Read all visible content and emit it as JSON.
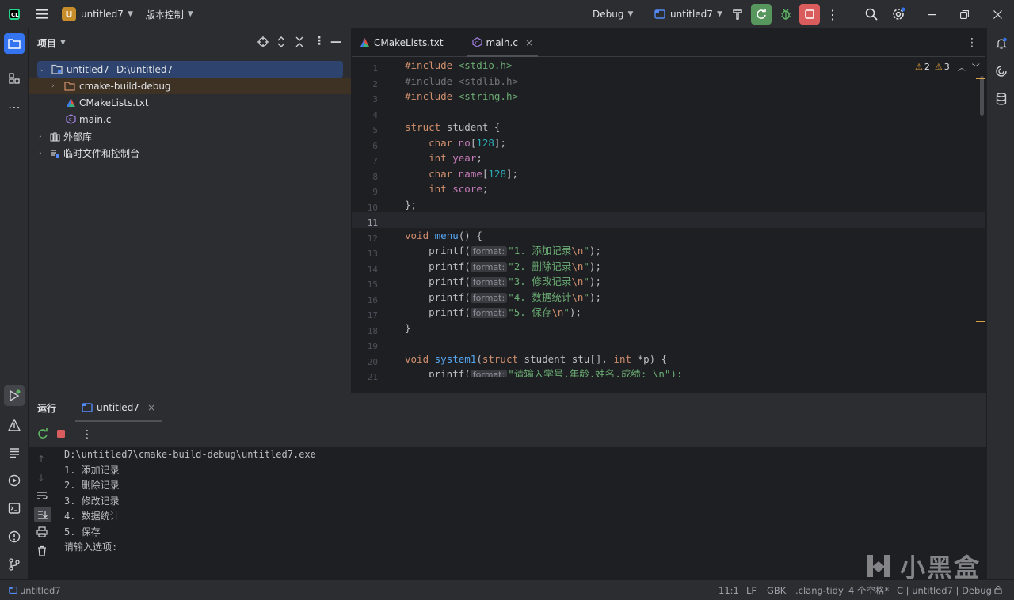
{
  "titlebar": {
    "project_initial": "U",
    "project_name": "untitled7",
    "vcs_label": "版本控制",
    "config_label": "Debug",
    "run_target": "untitled7"
  },
  "project_panel": {
    "title": "项目",
    "tree": [
      {
        "label": "untitled7",
        "path": "D:\\untitled7"
      },
      {
        "label": "cmake-build-debug"
      },
      {
        "label": "CMakeLists.txt"
      },
      {
        "label": "main.c"
      },
      {
        "label": "外部库"
      },
      {
        "label": "临时文件和控制台"
      }
    ]
  },
  "editor": {
    "tabs": [
      {
        "label": "CMakeLists.txt"
      },
      {
        "label": "main.c"
      }
    ],
    "warnings": {
      "weak": "2",
      "warn": "3"
    },
    "line_numbers": [
      "1",
      "2",
      "3",
      "4",
      "5",
      "6",
      "7",
      "8",
      "9",
      "10",
      "11",
      "12",
      "13",
      "14",
      "15",
      "16",
      "17",
      "18",
      "19",
      "20",
      "21"
    ],
    "hint_label": "format:",
    "lines": {
      "l1": "<stdio.h>",
      "l2": "<stdlib.h>",
      "l3": "<string.h>",
      "inc": "#include ",
      "struct_name": "student",
      "menu_items": [
        "\"1. 添加记录",
        "\"2. 删除记录",
        "\"3. 修改记录",
        "\"4. 数据统计",
        "\"5. 保存"
      ],
      "line21_str": "\"请输入学号,年龄,姓名,成绩: \\n\");"
    }
  },
  "run_panel": {
    "title": "运行",
    "tab_label": "untitled7",
    "console_lines": [
      "D:\\untitled7\\cmake-build-debug\\untitled7.exe",
      "1. 添加记录",
      "2. 删除记录",
      "3. 修改记录",
      "4. 数据统计",
      "5. 保存",
      "请输入选项:"
    ]
  },
  "statusbar": {
    "project": "untitled7",
    "position": "11:1",
    "line_sep": "LF",
    "encoding": "GBK",
    "inspector": ".clang-tidy",
    "indent": "4 个空格*",
    "context": "C | untitled7 | Debug"
  },
  "watermark": {
    "text": "小黑盒"
  },
  "colors": {
    "accent": "#3574f0",
    "run_green": "#57965c",
    "stop_red": "#db5c5c"
  }
}
